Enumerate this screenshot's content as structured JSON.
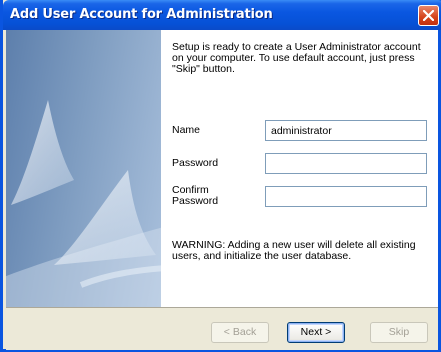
{
  "window": {
    "title": "Add User Account for Administration",
    "close_icon": "close-icon"
  },
  "content": {
    "intro": "Setup is ready to create a User Administrator account on your computer. To use default account, just press \"Skip\" button.",
    "name_label": "Name",
    "name_value": "administrator",
    "password_label": "Password",
    "password_value": "",
    "confirm_label_line1": "Confirm",
    "confirm_label_line2": "Password",
    "confirm_value": "",
    "warning": "WARNING: Adding a new user will delete all existing users, and initialize the user database."
  },
  "buttons": {
    "back": "< Back",
    "next": "Next >",
    "skip": "Skip"
  },
  "colors": {
    "titlebar": "#0a57e1",
    "panel": "#7f9dc1"
  }
}
